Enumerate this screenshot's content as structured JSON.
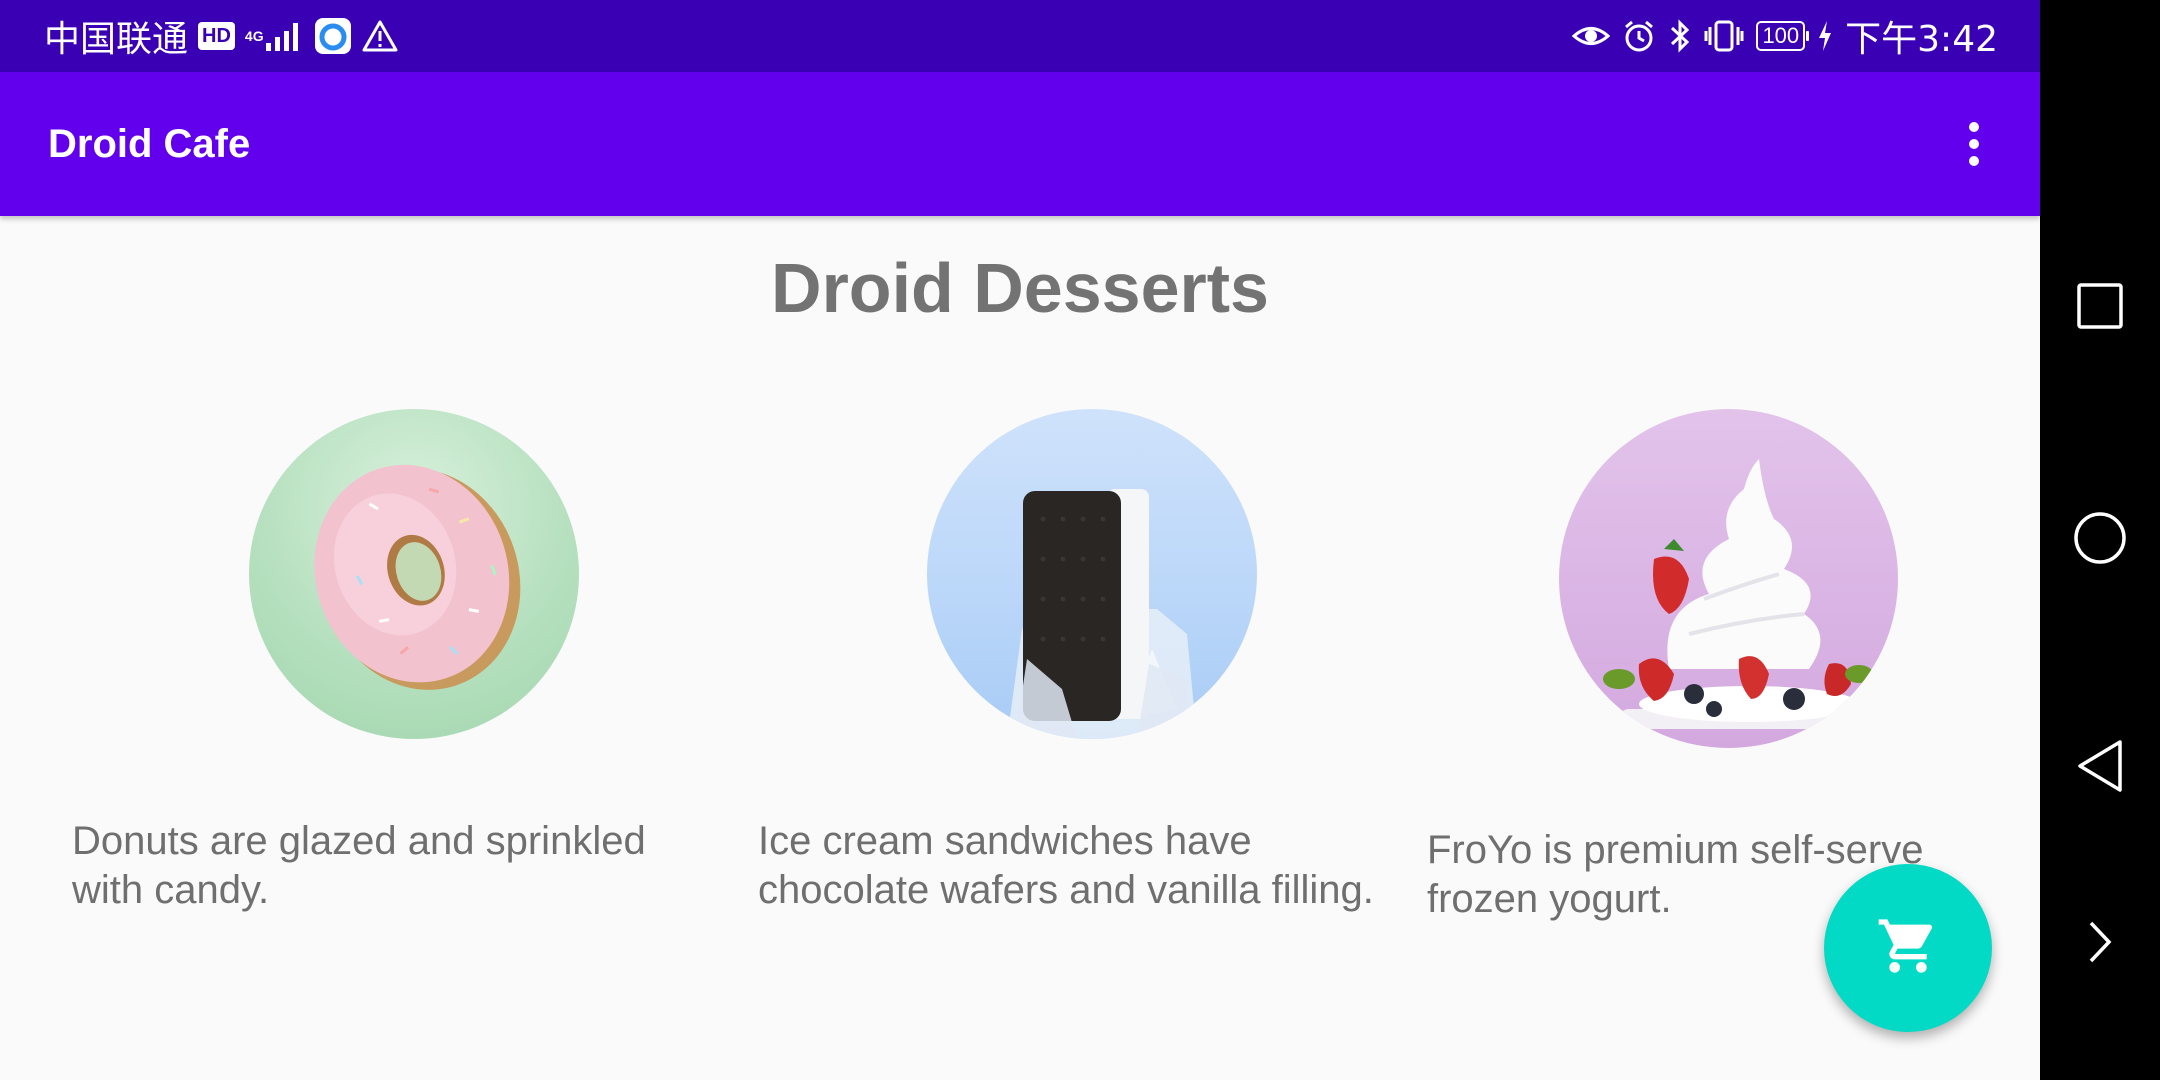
{
  "status_bar": {
    "carrier": "中国联通",
    "hd_badge": "HD",
    "network_type": "4G",
    "time": "下午3:42",
    "battery": "100"
  },
  "app_bar": {
    "title": "Droid Cafe",
    "menu_icon": "more-vert-icon"
  },
  "content": {
    "heading": "Droid Desserts",
    "items": [
      {
        "image": "donut",
        "description": "Donuts are glazed and sprinkled with candy."
      },
      {
        "image": "ice-cream-sandwich",
        "description": "Ice cream sandwiches have chocolate wafers and vanilla filling."
      },
      {
        "image": "froyo",
        "description": "FroYo is premium self-serve frozen yogurt."
      }
    ]
  },
  "fab": {
    "icon": "shopping-cart-icon",
    "color": "#03dac5"
  },
  "colors": {
    "status_bar": "#3a00b4",
    "app_bar": "#6200ee",
    "background": "#fafafa",
    "text": "#6f6f6f"
  },
  "nav_bar": {
    "buttons": [
      "recents-icon",
      "home-icon",
      "back-icon",
      "expand-icon"
    ]
  }
}
